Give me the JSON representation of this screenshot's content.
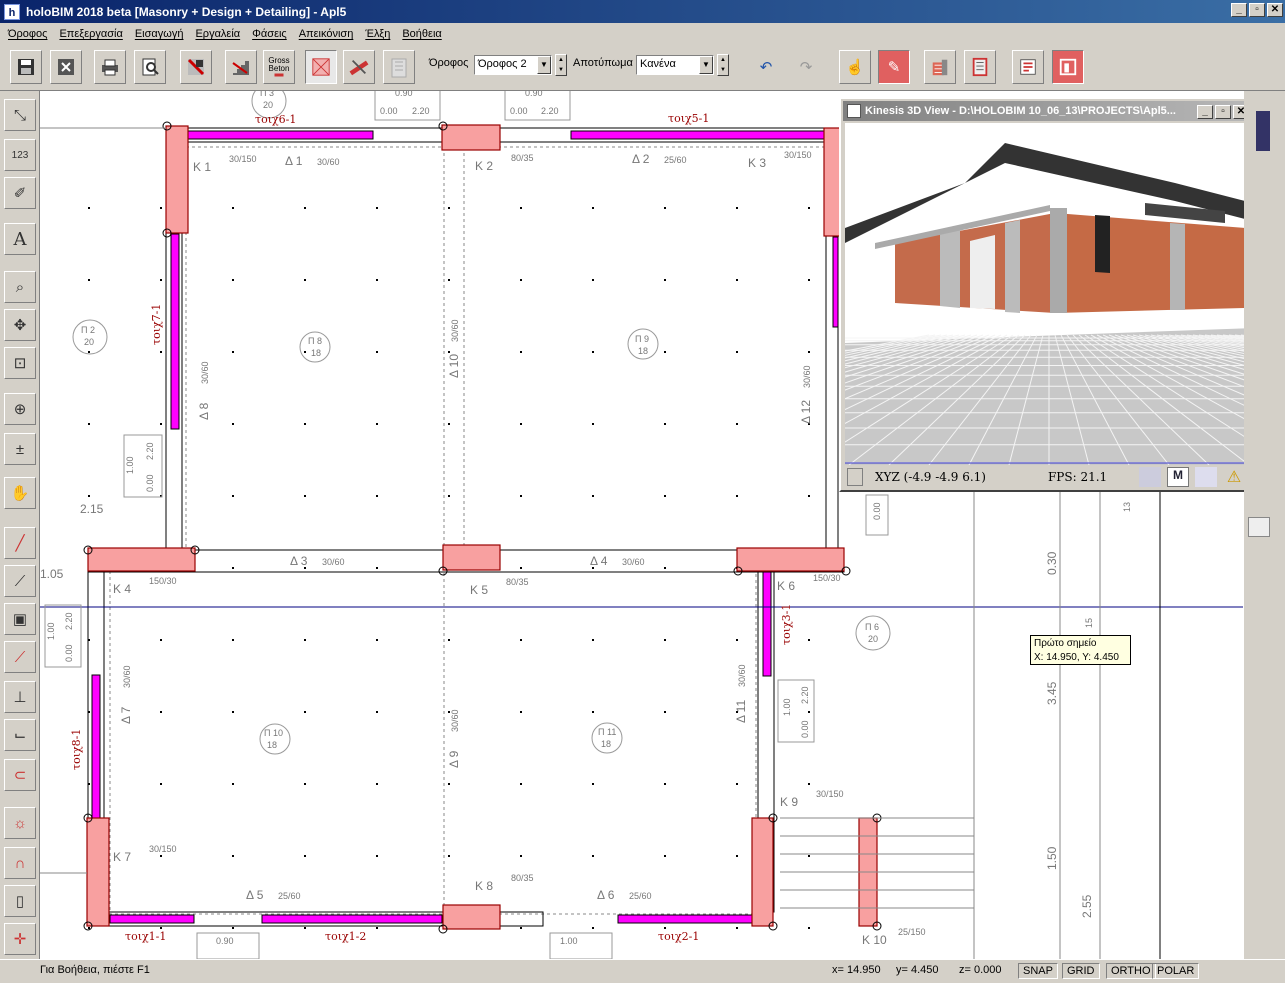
{
  "app": {
    "title": "holoBIM 2018 beta [Masonry + Design + Detailing] - Apl5",
    "icon_letter": "h"
  },
  "window_controls": {
    "minimize": "_",
    "restore": "▫",
    "close": "✕"
  },
  "menu": [
    "Όροφος",
    "Επεξεργασία",
    "Εισαγωγή",
    "Εργαλεία",
    "Φάσεις",
    "Απεικόνιση",
    "Έλξη",
    "Βοήθεια"
  ],
  "toolbar": {
    "floor_label": "Όροφος",
    "floor_value": "Όροφος 2",
    "imprint_label": "Αποτύπωμα",
    "imprint_value": "Κανένα",
    "gross_label_1": "Gross",
    "gross_label_2": "Beton"
  },
  "view3d": {
    "title": "Kinesis 3D View - D:\\HOLOBIM 10_06_13\\PROJECTS\\Apl5...",
    "xyz": "XYZ (-4.9 -4.9 6.1)",
    "fps": "FPS: 21.1",
    "m_label": "M"
  },
  "tooltip": {
    "line1": "Πρώτο σημείο",
    "line2": "X: 14.950, Y: 4.450"
  },
  "status": {
    "help": "Για Βοήθεια, πιέστε F1",
    "x": "x= 14.950",
    "y": "y= 4.450",
    "z": "z= 0.000",
    "snap": "SNAP",
    "grid": "GRID",
    "ortho": "ORTHO",
    "polar": "POLAR"
  },
  "drawing": {
    "columns": [
      {
        "name": "K 1",
        "dim": "30/150"
      },
      {
        "name": "K 2",
        "dim": "80/35"
      },
      {
        "name": "K 3",
        "dim": "30/150"
      },
      {
        "name": "K 4",
        "dim": "150/30"
      },
      {
        "name": "K 5",
        "dim": "80/35"
      },
      {
        "name": "K 6",
        "dim": "150/30"
      },
      {
        "name": "K 7",
        "dim": "30/150"
      },
      {
        "name": "K 8",
        "dim": "80/35"
      },
      {
        "name": "K 9",
        "dim": "30/150"
      },
      {
        "name": "K 10",
        "dim": "25/150"
      }
    ],
    "beams": [
      {
        "name": "Δ 1",
        "dim": "30/60"
      },
      {
        "name": "Δ 2",
        "dim": "25/60"
      },
      {
        "name": "Δ 3",
        "dim": "30/60"
      },
      {
        "name": "Δ 4",
        "dim": "30/60"
      },
      {
        "name": "Δ 5",
        "dim": "25/60"
      },
      {
        "name": "Δ 6",
        "dim": "25/60"
      },
      {
        "name": "Δ 7",
        "dim": "30/60"
      },
      {
        "name": "Δ 8",
        "dim": "30/60"
      },
      {
        "name": "Δ 9",
        "dim": "30/60"
      },
      {
        "name": "Δ 10",
        "dim": "30/60"
      },
      {
        "name": "Δ 11",
        "dim": "30/60"
      },
      {
        "name": "Δ 12",
        "dim": "30/60"
      }
    ],
    "slabs": [
      {
        "name": "Π 2",
        "val": "20"
      },
      {
        "name": "Π 8",
        "val": "18"
      },
      {
        "name": "Π 9",
        "val": "18"
      },
      {
        "name": "Π 6",
        "val": "20"
      },
      {
        "name": "Π 10",
        "val": "18"
      },
      {
        "name": "Π 11",
        "val": "18"
      },
      {
        "name": "Π 3",
        "val": "20"
      }
    ],
    "walls": [
      "τοιχ6-1",
      "τοιχ5-1",
      "τοιχ7-1",
      "τοιχ3-1",
      "τοιχ8-1",
      "τοιχ1-1",
      "τοιχ1-2",
      "τοιχ2-1"
    ],
    "dims": {
      "d215": "2.15",
      "d105": "1.05",
      "d090a": "0.90",
      "d090b": "0.90",
      "d090c": "0.90",
      "d100": "1.00",
      "d000": "0.00",
      "d220": "2.20",
      "d345": "3.45",
      "d150": "1.50",
      "d255": "2.55",
      "d030": "0.30",
      "d13": "13",
      "d15": "15"
    }
  }
}
